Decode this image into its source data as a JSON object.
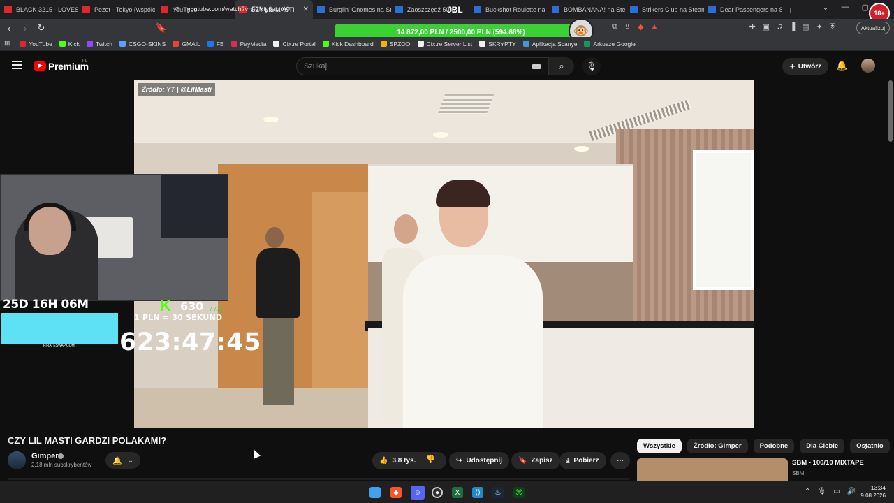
{
  "browser": {
    "tabs": [
      {
        "label": "BLACK 3215 - LOVEST",
        "favicon": "youtube-icon"
      },
      {
        "label": "Pezet - Tokyo (wspólc",
        "favicon": "youtube-icon"
      },
      {
        "label": "YouTube",
        "favicon": "youtube-icon"
      },
      {
        "label": "CZY LIL MASTI",
        "favicon": "youtube-icon",
        "active": true
      },
      {
        "label": "Burglin' Gnomes na St",
        "favicon": "steam-icon"
      },
      {
        "label": "Zaoszczędź 50%",
        "favicon": "steam-icon"
      },
      {
        "label": "Buckshot Roulette na",
        "favicon": "steam-icon"
      },
      {
        "label": "BOMBANANA! na Ste",
        "favicon": "steam-icon"
      },
      {
        "label": "Strikers Club na Steam",
        "favicon": "steam-icon"
      },
      {
        "label": "Dear Passengers na St",
        "favicon": "steam-icon"
      }
    ],
    "new_tab": "+",
    "url": "youtube.com/watch?v=F2Nty6acnA0",
    "update_label": "Aktualizuj",
    "profile_badge": "18+",
    "jbl_text": "JBL",
    "bookmarks": [
      {
        "label": "YouTube",
        "color": "#e0262d"
      },
      {
        "label": "Kick",
        "color": "#53fc18"
      },
      {
        "label": "Twitch",
        "color": "#9146ff"
      },
      {
        "label": "CSGO-SKINS",
        "color": "#5aa0ff"
      },
      {
        "label": "GMAIL",
        "color": "#ea4335"
      },
      {
        "label": "FB",
        "color": "#1877f2"
      },
      {
        "label": "PayMedia",
        "color": "#d62c55"
      },
      {
        "label": "Cfx.re Portal",
        "color": "#f0f0f0"
      },
      {
        "label": "Kick Dashboard",
        "color": "#53fc18"
      },
      {
        "label": "SPZOO",
        "color": "#f4b400"
      },
      {
        "label": "Cfx.re Server List",
        "color": "#f0f0f0"
      },
      {
        "label": "SKRYPTY",
        "color": "#f0f0f0"
      },
      {
        "label": "Aplikacja Scanye",
        "color": "#3f9ad8"
      },
      {
        "label": "Arkusze Google",
        "color": "#0f9d58"
      }
    ]
  },
  "overlay_banner": {
    "text": "14 872,00 PLN / 2500,00 PLN  (594.88%)",
    "color": "#3bd135"
  },
  "youtube": {
    "brand": "Premium",
    "region": "PL",
    "search_placeholder": "Szukaj",
    "create_label": "Utwórz"
  },
  "video": {
    "watermark": "Źródło: YT | @LilMasti"
  },
  "stream_overlay": {
    "subathon_days": "25D 16H 06M",
    "kick_letter": "K",
    "kick_count": "630",
    "kick_goal": "/ 700",
    "rate": "1 PLN = 30 SEKUND",
    "sponsor": "PIRATESWAP.COM",
    "countdown": "623:47:45"
  },
  "watch": {
    "title": "CZY LIL MASTI GARDZI POLAKAMI?",
    "channel": "Gimper",
    "subscribers": "2,18 mln subskrybentów",
    "likes": "3,8 tys.",
    "share": "Udostępnij",
    "save": "Zapisz",
    "download": "Pobierz",
    "more": "⋯"
  },
  "recommendations": {
    "chips": [
      {
        "label": "Wszystkie",
        "active": true
      },
      {
        "label": "Źródło: Gimper"
      },
      {
        "label": "Podobne"
      },
      {
        "label": "Dla Ciebie"
      },
      {
        "label": "Ostatnio"
      }
    ],
    "first": {
      "title": "SBM - 100/10 MIXTAPE",
      "channel": "SBM"
    }
  },
  "taskbar": {
    "time": "13:34",
    "date": "9.08.2026"
  }
}
